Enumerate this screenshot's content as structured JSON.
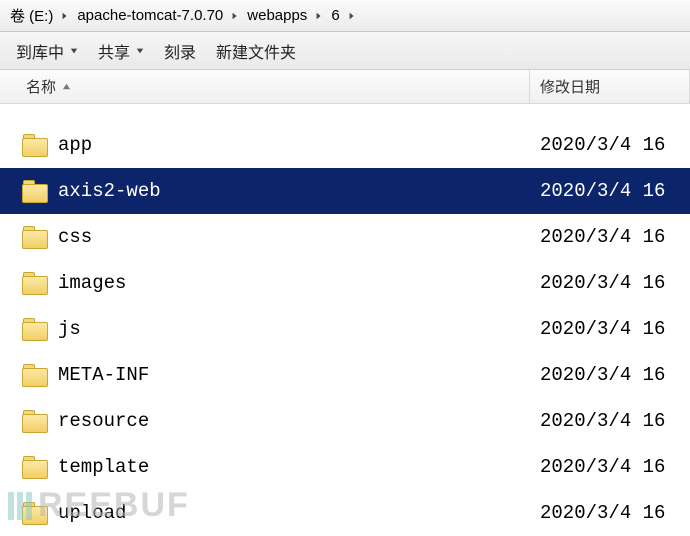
{
  "breadcrumb": {
    "items": [
      {
        "label": "卷 (E:)"
      },
      {
        "label": "apache-tomcat-7.0.70"
      },
      {
        "label": "webapps"
      },
      {
        "label": "6"
      }
    ]
  },
  "toolbar": {
    "library": "到库中",
    "share": "共享",
    "burn": "刻录",
    "new_folder": "新建文件夹"
  },
  "columns": {
    "name": "名称",
    "date": "修改日期"
  },
  "files": [
    {
      "name": "app",
      "date": "2020/3/4 16",
      "selected": false
    },
    {
      "name": "axis2-web",
      "date": "2020/3/4 16",
      "selected": true
    },
    {
      "name": "css",
      "date": "2020/3/4 16",
      "selected": false
    },
    {
      "name": "images",
      "date": "2020/3/4 16",
      "selected": false
    },
    {
      "name": "js",
      "date": "2020/3/4 16",
      "selected": false
    },
    {
      "name": "META-INF",
      "date": "2020/3/4 16",
      "selected": false
    },
    {
      "name": "resource",
      "date": "2020/3/4 16",
      "selected": false
    },
    {
      "name": "template",
      "date": "2020/3/4 16",
      "selected": false
    },
    {
      "name": "upload",
      "date": "2020/3/4 16",
      "selected": false
    }
  ],
  "watermark": "REEBUF"
}
